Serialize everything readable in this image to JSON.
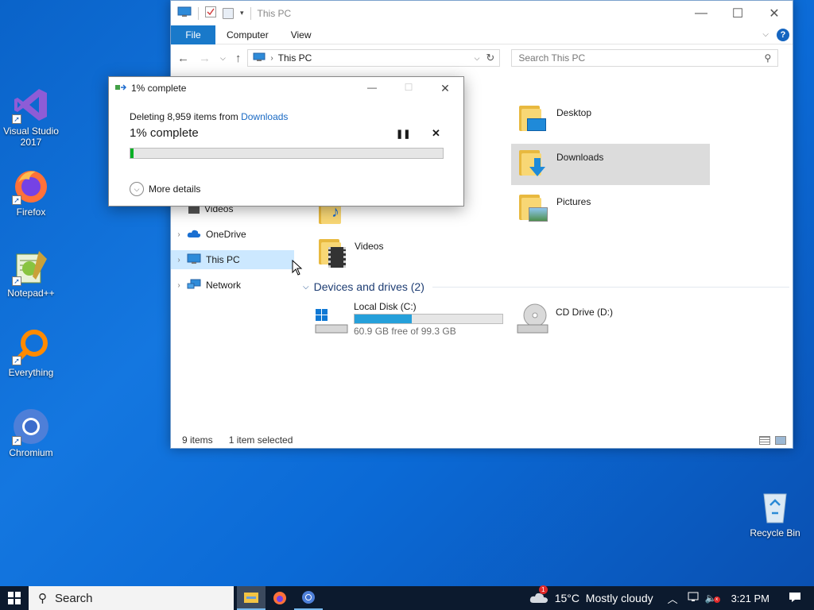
{
  "desktop": {
    "icons": [
      {
        "label_line1": "Visual Studio",
        "label_line2": "2017"
      },
      {
        "label_line1": "Firefox",
        "label_line2": ""
      },
      {
        "label_line1": "Notepad++",
        "label_line2": ""
      },
      {
        "label_line1": "Everything",
        "label_line2": ""
      },
      {
        "label_line1": "Chromium",
        "label_line2": ""
      }
    ],
    "recycle_bin": "Recycle Bin"
  },
  "explorer": {
    "title": "This PC",
    "ribbon_tabs": [
      "File",
      "Computer",
      "View"
    ],
    "address": "This PC",
    "search_placeholder": "Search This PC",
    "nav": {
      "videos": "Videos",
      "onedrive": "OneDrive",
      "this_pc": "This PC",
      "network": "Network"
    },
    "folders": {
      "desktop": "Desktop",
      "downloads": "Downloads",
      "pictures": "Pictures",
      "videos": "Videos"
    },
    "drives_header": "Devices and drives (2)",
    "drives": [
      {
        "name": "Local Disk (C:)",
        "free_text": "60.9 GB free of 99.3 GB",
        "used_fraction": 0.387
      },
      {
        "name": "CD Drive (D:)"
      }
    ],
    "status": {
      "items": "9 items",
      "selected": "1 item selected"
    }
  },
  "dialog": {
    "title": "1% complete",
    "line_prefix": "Deleting 8,959 items from ",
    "line_link": "Downloads",
    "big_text": "1% complete",
    "progress_fraction": 0.01,
    "more_details": "More details"
  },
  "taskbar": {
    "search": "Search",
    "weather": "15°C  Mostly cloudy",
    "weather_badge": "1",
    "time": "3:21 PM"
  },
  "colors": {
    "accent": "#1979ca",
    "link": "#1a6ac4",
    "progress": "#26a0da",
    "selection": "#dcdcdc"
  }
}
